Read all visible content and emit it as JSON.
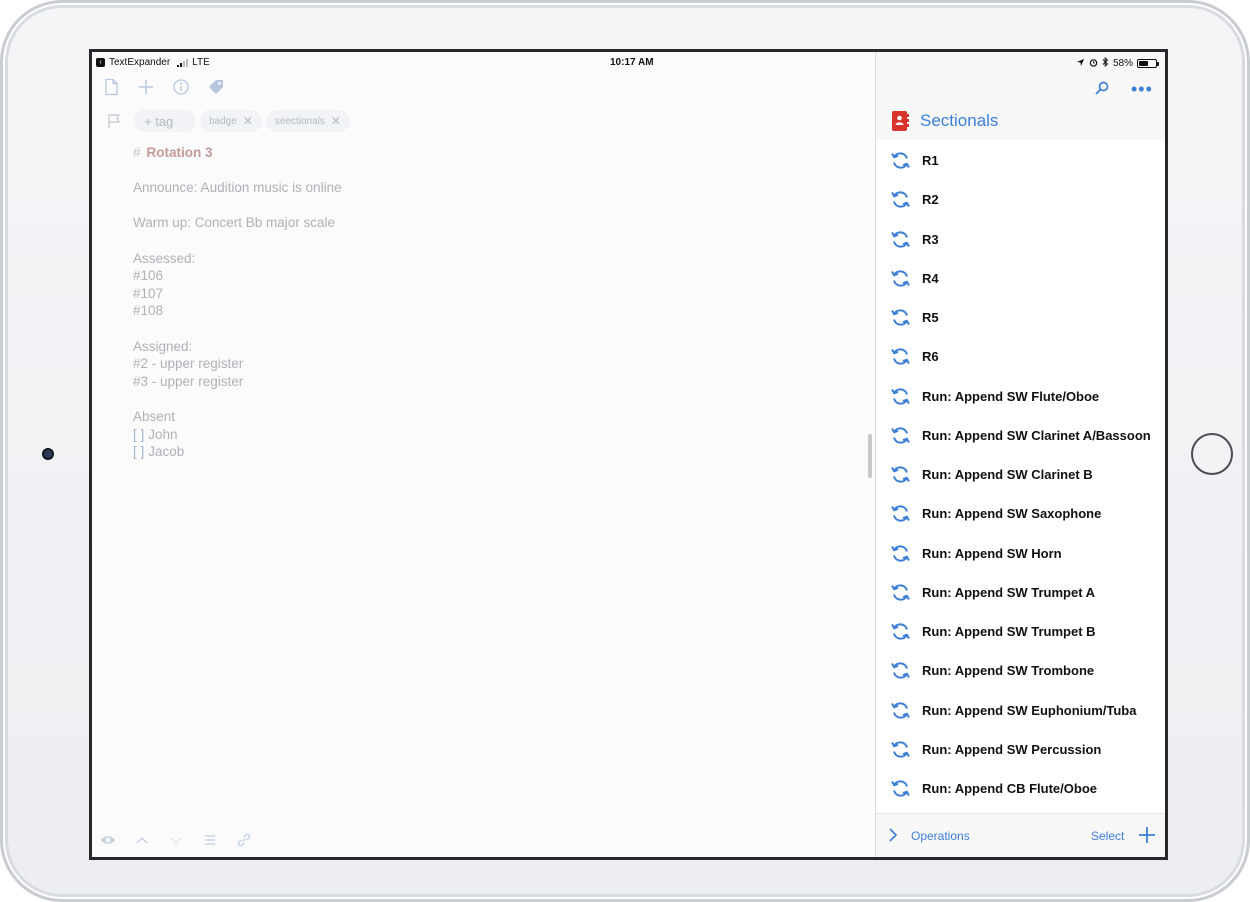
{
  "status_bar": {
    "app_back": "TextExpander",
    "carrier": "LTE",
    "time": "10:17 AM",
    "battery": "58%",
    "battery_level": 0.58
  },
  "editor": {
    "toolbar_icons": [
      "new-document-icon",
      "plus-icon",
      "info-icon",
      "tag-icon"
    ],
    "tags": {
      "add_label": "+ tag",
      "items": [
        "badge",
        "seectionals"
      ]
    },
    "document": {
      "heading_marker": "#",
      "heading": "Rotation 3",
      "announce": "Announce: Audition music is online",
      "warmup": "Warm up: Concert Bb major scale",
      "assessed_label": "Assessed:",
      "assessed": [
        "#106",
        "#107",
        "#108"
      ],
      "assigned_label": "Assigned:",
      "assigned": [
        "#2 - upper register",
        "#3 - upper register"
      ],
      "absent_label": "Absent",
      "checkbox": "[  ]",
      "absent": [
        "John",
        "Jacob"
      ]
    },
    "bottom_icons": [
      "eye-icon",
      "chevron-up-icon",
      "chevron-down-icon",
      "list-icon",
      "link-icon"
    ]
  },
  "panel": {
    "group_title": "Sectionals",
    "actions": [
      "R1",
      "R2",
      "R3",
      "R4",
      "R5",
      "R6",
      "Run: Append SW Flute/Oboe",
      "Run: Append SW Clarinet A/Bassoon",
      "Run: Append SW Clarinet B",
      "Run: Append SW Saxophone",
      "Run: Append SW Horn",
      "Run: Append SW Trumpet A",
      "Run: Append SW Trumpet B",
      "Run: Append SW Trombone",
      "Run: Append SW Euphonium/Tuba",
      "Run: Append SW Percussion",
      "Run: Append CB Flute/Oboe"
    ],
    "footer": {
      "operations": "Operations",
      "select": "Select"
    }
  },
  "colors": {
    "accent": "#3c7fd6",
    "heading": "#c39a9a",
    "body_text": "#aeb1b6",
    "group_icon": "#d9332e"
  }
}
